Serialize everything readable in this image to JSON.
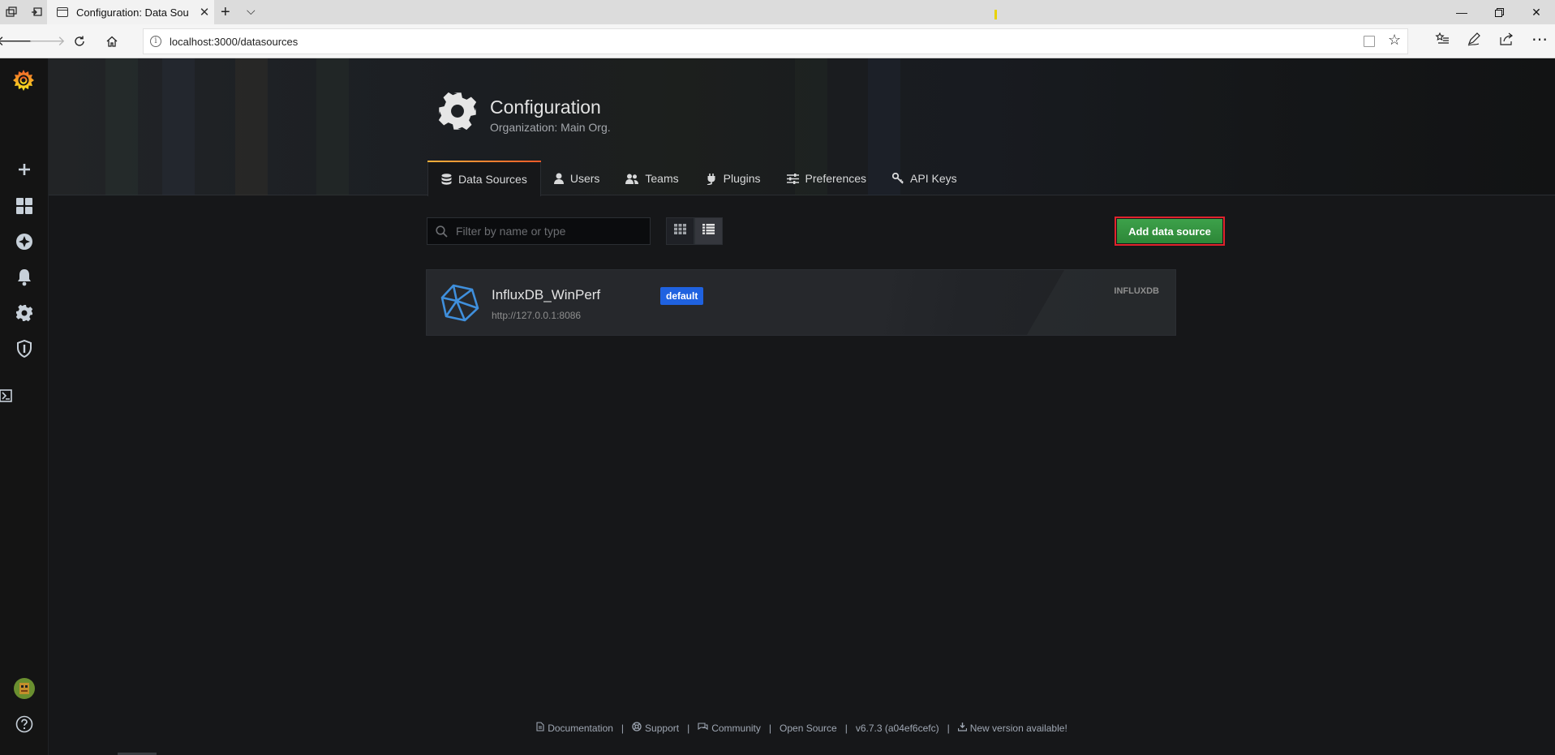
{
  "browser": {
    "tab_title": "Configuration: Data Sou",
    "url": "localhost:3000/datasources"
  },
  "colors": {
    "accent_green": "#3da14a",
    "badge_blue": "#1f62e0",
    "highlight_red": "#e0232c",
    "tab_gradient_start": "#fbb03b",
    "tab_gradient_end": "#f05a28"
  },
  "sidebar": {
    "items": [
      {
        "name": "grafana-logo-icon"
      },
      {
        "name": "create-icon"
      },
      {
        "name": "dashboards-icon"
      },
      {
        "name": "explore-icon"
      },
      {
        "name": "alerting-icon"
      },
      {
        "name": "configuration-icon"
      },
      {
        "name": "server-admin-icon"
      }
    ],
    "bottom": [
      {
        "name": "user-avatar"
      },
      {
        "name": "help-icon"
      }
    ]
  },
  "header": {
    "title": "Configuration",
    "subtitle": "Organization: Main Org."
  },
  "tabs": [
    {
      "label": "Data Sources",
      "icon": "database-icon",
      "active": true
    },
    {
      "label": "Users",
      "icon": "user-icon",
      "active": false
    },
    {
      "label": "Teams",
      "icon": "users-icon",
      "active": false
    },
    {
      "label": "Plugins",
      "icon": "plug-icon",
      "active": false
    },
    {
      "label": "Preferences",
      "icon": "sliders-icon",
      "active": false
    },
    {
      "label": "API Keys",
      "icon": "key-icon",
      "active": false
    }
  ],
  "toolbar": {
    "filter_placeholder": "Filter by name or type",
    "add_button_label": "Add data source"
  },
  "datasources": [
    {
      "name": "InfluxDB_WinPerf",
      "badge": "default",
      "url": "http://127.0.0.1:8086",
      "type": "INFLUXDB"
    }
  ],
  "footer": {
    "documentation": "Documentation",
    "support": "Support",
    "community": "Community",
    "open_source": "Open Source",
    "version": "v6.7.3 (a04ef6cefc)",
    "new_version": "New version available!"
  }
}
